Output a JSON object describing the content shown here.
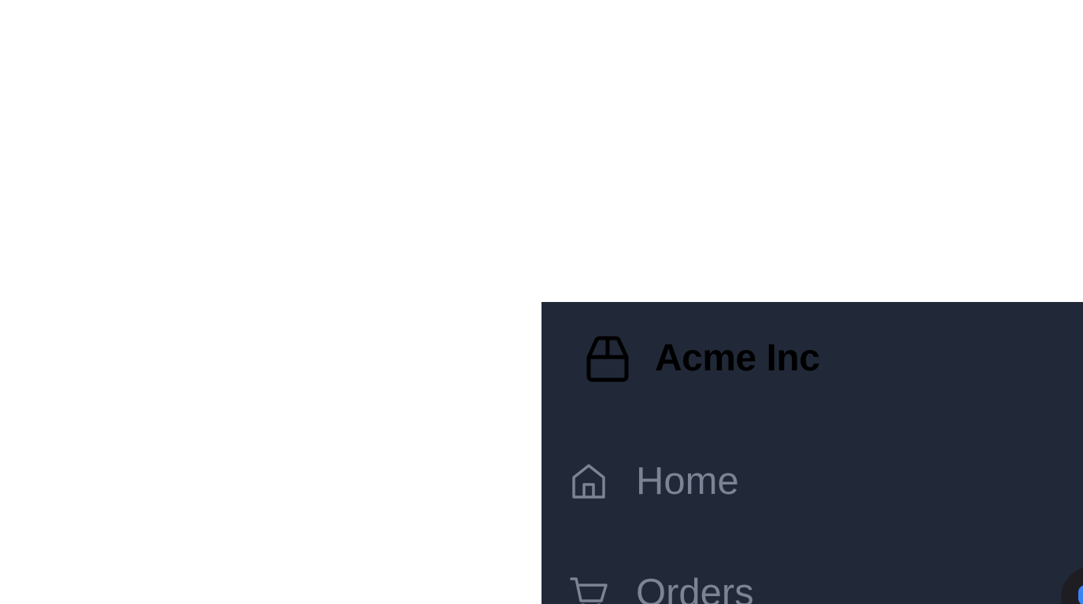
{
  "sidebar": {
    "brand": {
      "icon": "package-icon",
      "name": "Acme Inc"
    },
    "items": [
      {
        "icon": "home-icon",
        "label": "Home"
      },
      {
        "icon": "shopping-cart-icon",
        "label": "Orders"
      }
    ]
  },
  "colors": {
    "sidebar_background": "#212938",
    "brand_text": "#000000",
    "nav_text": "#7b8394"
  }
}
